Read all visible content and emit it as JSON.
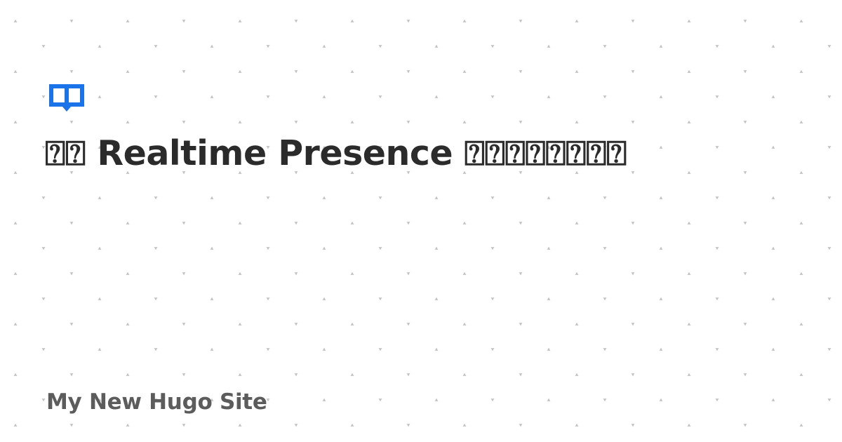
{
  "header": {
    "logo_icon": "book-icon",
    "accent_color": "#1a73e8"
  },
  "main": {
    "title": "⍰⍰ Realtime Presence ⍰⍰⍰⍰⍰⍰⍰⍰"
  },
  "footer": {
    "site_name": "My New Hugo Site"
  },
  "background": {
    "pattern": "dotted-triangles",
    "dot_color": "#c8c8c8"
  }
}
